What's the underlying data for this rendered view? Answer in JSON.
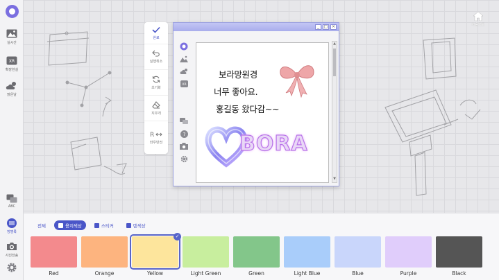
{
  "sidebar": {
    "items": [
      {
        "label": "실시간",
        "icon": "image-icon"
      },
      {
        "label": "확장현실",
        "icon": "xr-icon"
      },
      {
        "label": "맑은날",
        "icon": "weather-icon"
      },
      {
        "label": "ABC",
        "icon": "chat-icon"
      },
      {
        "label": "방명록",
        "icon": "guestbook-icon"
      },
      {
        "label": "사진전송",
        "icon": "camera-icon"
      }
    ],
    "settings_icon": "gear-icon"
  },
  "home": {
    "label": "처음으로"
  },
  "toolbar": {
    "items": [
      {
        "label": "완료",
        "icon": "check-icon"
      },
      {
        "label": "실행취소",
        "icon": "undo-icon"
      },
      {
        "label": "초기화",
        "icon": "refresh-icon"
      },
      {
        "label": "지우개",
        "icon": "eraser-icon"
      },
      {
        "label": "좌우반전",
        "icon": "flip-icon"
      }
    ]
  },
  "window": {
    "buttons": [
      "_",
      "□",
      "×"
    ]
  },
  "note": {
    "lines": [
      "보라망원경",
      "너무 좋아요.",
      "홍길동 왔다감~~"
    ],
    "sticker_text": "BORA"
  },
  "tabs": [
    {
      "label": "전체",
      "active": false
    },
    {
      "label": "용지색상",
      "active": true
    },
    {
      "label": "스티커",
      "active": false
    },
    {
      "label": "텐색상",
      "active": false
    }
  ],
  "swatches": [
    {
      "name": "Red",
      "color": "#f38a8d"
    },
    {
      "name": "Orange",
      "color": "#fdb47f"
    },
    {
      "name": "Yellow",
      "color": "#fde59c"
    },
    {
      "name": "Light Green",
      "color": "#c8ee9e"
    },
    {
      "name": "Green",
      "color": "#83c68a"
    },
    {
      "name": "Light Blue",
      "color": "#a9cdfa"
    },
    {
      "name": "Blue",
      "color": "#c9d6fb"
    },
    {
      "name": "Purple",
      "color": "#e0cdfb"
    },
    {
      "name": "Black",
      "color": "#555555"
    }
  ],
  "selected_swatch": "Yellow",
  "accent_color": "#4a56c8"
}
